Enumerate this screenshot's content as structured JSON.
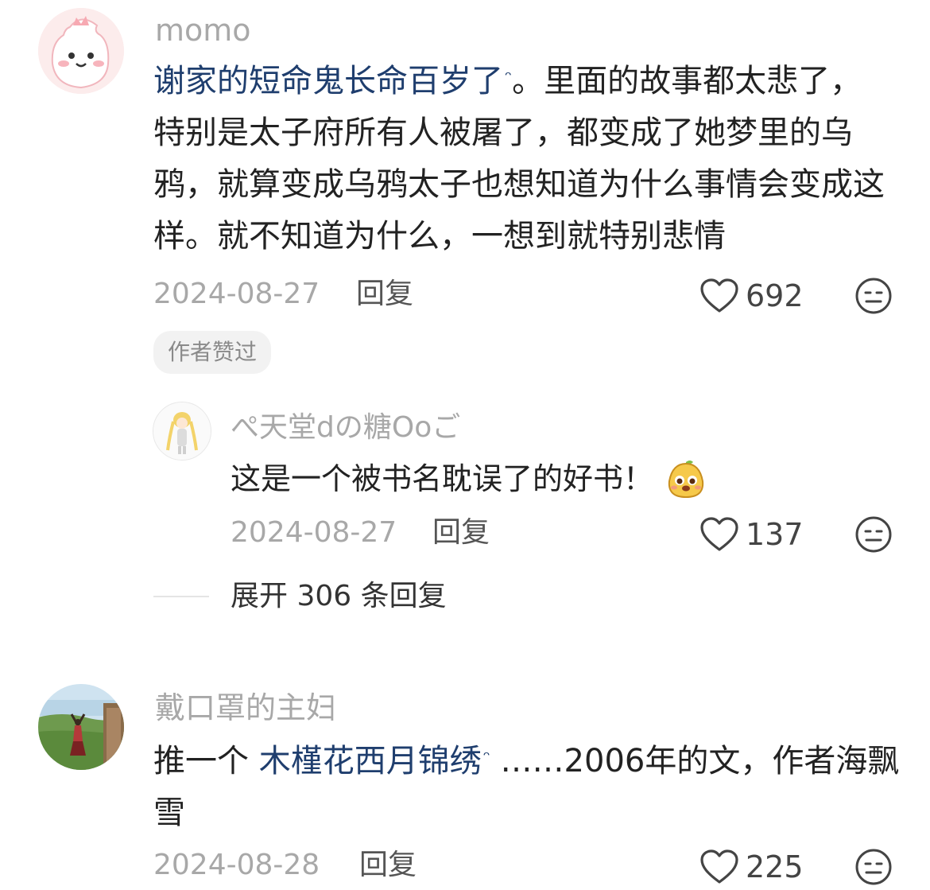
{
  "comments": [
    {
      "username": "momo",
      "text_link": "谢家的短命鬼长命百岁了",
      "text_rest": "。里面的故事都太悲了，特别是太子府所有人被屠了，都变成了她梦里的乌鸦，就算变成乌鸦太子也想知道为什么事情会变成这样。就不知道为什么，一想到就特别悲情",
      "date": "2024-08-27",
      "reply_label": "回复",
      "likes": "692",
      "badge": "作者赞过"
    },
    {
      "username": "戴口罩的主妇",
      "text_prefix": "推一个 ",
      "text_link": "木槿花西月锦绣",
      "text_rest": " ……2006年的文，作者海飘雪",
      "date": "2024-08-28",
      "reply_label": "回复",
      "likes": "225"
    }
  ],
  "reply": {
    "username": "ぺ天堂dの糖Ooご",
    "text": "这是一个被书名耽误了的好书！",
    "date": "2024-08-27",
    "reply_label": "回复",
    "likes": "137"
  },
  "expand_label": "展开 306 条回复",
  "icons": {
    "search_mark": "ᵔ"
  },
  "colors": {
    "link": "#1f3e6e",
    "muted": "#a8a8a8"
  }
}
